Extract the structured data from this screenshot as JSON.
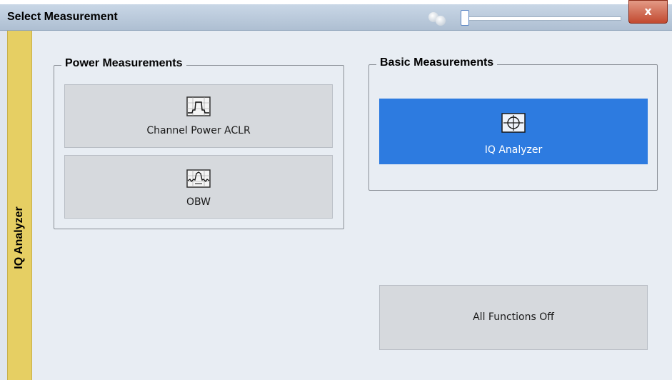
{
  "dialog": {
    "title": "Select Measurement",
    "close_label": "x"
  },
  "side_tab": {
    "label": "IQ Analyzer"
  },
  "power_group": {
    "title": "Power Measurements",
    "buttons": [
      {
        "label": "Channel Power ACLR",
        "icon": "channel-power-aclr-icon"
      },
      {
        "label": "OBW",
        "icon": "obw-icon"
      }
    ]
  },
  "basic_group": {
    "title": "Basic Measurements",
    "buttons": [
      {
        "label": "IQ Analyzer",
        "icon": "iq-analyzer-icon",
        "selected": true
      }
    ]
  },
  "all_functions_off": {
    "label": "All Functions Off"
  },
  "colors": {
    "selected": "#2d7be0",
    "tab": "#e6cf63",
    "close": "#c24a30"
  }
}
